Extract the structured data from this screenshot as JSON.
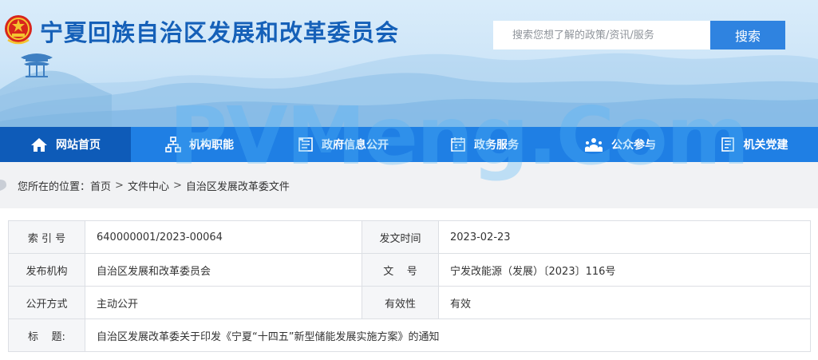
{
  "header": {
    "site_title": "宁夏回族自治区发展和改革委员会",
    "search_placeholder": "搜索您想了解的政策/资讯/服务",
    "search_button": "搜索"
  },
  "nav": {
    "items": [
      {
        "label": "网站首页",
        "icon": "home-icon"
      },
      {
        "label": "机构职能",
        "icon": "org-chart-icon"
      },
      {
        "label": "政府信息公开",
        "icon": "document-list-icon"
      },
      {
        "label": "政务服务",
        "icon": "calendar-service-icon"
      },
      {
        "label": "公众参与",
        "icon": "people-icon"
      },
      {
        "label": "机关党建",
        "icon": "notes-icon"
      }
    ]
  },
  "breadcrumb": {
    "prefix": "您所在的位置：",
    "items": [
      "首页",
      "文件中心",
      "自治区发展改革委文件"
    ],
    "separator": ">"
  },
  "info": {
    "index_label": "索 引 号",
    "index_value": "640000001/2023-00064",
    "date_label": "发文时间",
    "date_value": "2023-02-23",
    "issuer_label": "发布机构",
    "issuer_value": "自治区发展和改革委员会",
    "docno_label": "文    号",
    "docno_value": "宁发改能源（发展）〔2023〕116号",
    "disclosure_label": "公开方式",
    "disclosure_value": "主动公开",
    "validity_label": "有效性",
    "validity_value": "有效",
    "title_label": "标    题:",
    "title_value": "自治区发展改革委关于印发《宁夏“十四五”新型储能发展实施方案》的通知"
  },
  "watermark": "PVMeng.Com",
  "colors": {
    "nav_bg": "#1f7fe4",
    "nav_active": "#0e5bb8",
    "search_button": "#2f83e0",
    "title": "#1560b8"
  }
}
